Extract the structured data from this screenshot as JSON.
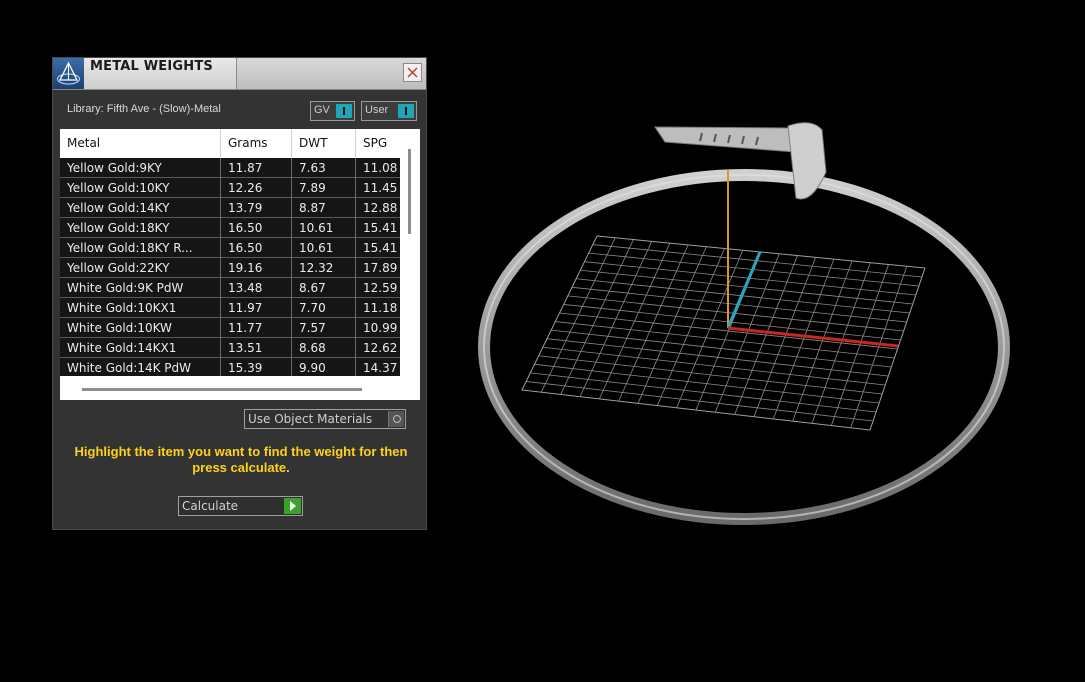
{
  "panel": {
    "title": "METAL WEIGHTS",
    "library_label": "Library: Fifth Ave - (Slow)-Metal",
    "toggle_gv": "GV",
    "toggle_user": "User",
    "use_object_materials": "Use Object Materials",
    "hint": "Highlight the item you want to find the weight for then press calculate.",
    "calculate_label": "Calculate"
  },
  "table": {
    "headers": [
      "Metal",
      "Grams",
      "DWT",
      "SPG"
    ],
    "rows": [
      [
        "Yellow Gold:9KY",
        "11.87",
        "7.63",
        "11.08"
      ],
      [
        "Yellow Gold:10KY",
        "12.26",
        "7.89",
        "11.45"
      ],
      [
        "Yellow Gold:14KY",
        "13.79",
        "8.87",
        "12.88"
      ],
      [
        "Yellow Gold:18KY",
        "16.50",
        "10.61",
        "15.41"
      ],
      [
        "Yellow Gold:18KY R...",
        "16.50",
        "10.61",
        "15.41"
      ],
      [
        "Yellow Gold:22KY",
        "19.16",
        "12.32",
        "17.89"
      ],
      [
        "White Gold:9K PdW",
        "13.48",
        "8.67",
        "12.59"
      ],
      [
        "White Gold:10KX1",
        "11.97",
        "7.70",
        "11.18"
      ],
      [
        "White Gold:10KW",
        "11.77",
        "7.57",
        "10.99"
      ],
      [
        "White Gold:14KX1",
        "13.51",
        "8.68",
        "12.62"
      ],
      [
        "White Gold:14K PdW",
        "15.39",
        "9.90",
        "14.37"
      ]
    ]
  },
  "colors": {
    "hint_text": "#ffd21a",
    "toggle_accent": "#20a5b8",
    "calculate_accent": "#3aa12a",
    "axis_x": "#c8281e",
    "axis_y": "#d9962a",
    "axis_z": "#2aa4c4"
  },
  "icons": {
    "app_logo": "pyramid-logo-icon",
    "close": "close-icon",
    "toggle_knob": "toggle-switch-icon",
    "dropdown": "dropdown-circle-icon",
    "go_arrow": "play-arrow-icon"
  }
}
